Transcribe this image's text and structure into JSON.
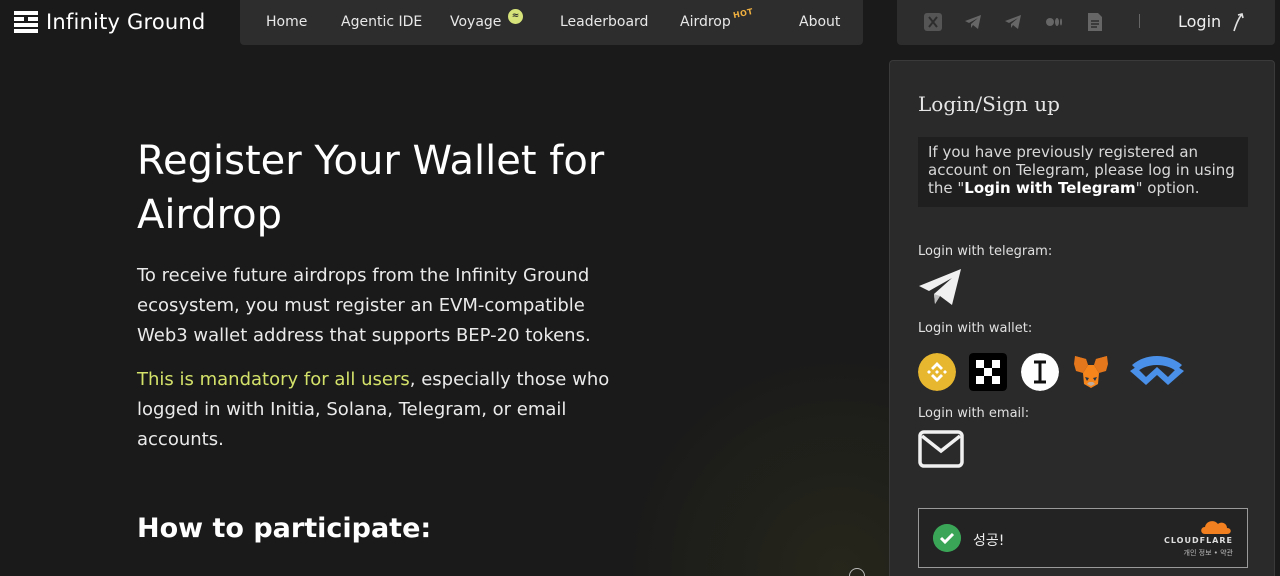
{
  "brand": {
    "name": "Infinity Ground"
  },
  "nav": {
    "items": [
      {
        "label": "Home"
      },
      {
        "label": "Agentic IDE"
      },
      {
        "label": "Voyage"
      },
      {
        "label": "Leaderboard"
      },
      {
        "label": "Airdrop",
        "badge": "HOT"
      },
      {
        "label": "About"
      }
    ]
  },
  "social": {
    "icons": [
      "x-icon",
      "telegram-icon",
      "telegram-icon",
      "medium-icon",
      "docs-icon"
    ],
    "login_label": "Login"
  },
  "main": {
    "title": "Register Your Wallet for Airdrop",
    "para1": "To receive future airdrops from the Infinity Ground ecosystem, you must register an EVM-compatible Web3 wallet address that supports BEP-20 tokens.",
    "para2_highlight": "This is mandatory for all users",
    "para2_rest": ", especially those who logged in with Initia, Solana, Telegram, or email accounts.",
    "how_title": "How to participate:"
  },
  "panel": {
    "title": "Login/Sign up",
    "notice_pre": "If you have previously registered an account on Telegram, please log in using the \"",
    "notice_bold": "Login with Telegram",
    "notice_post": "\" option.",
    "telegram_label": "Login with telegram:",
    "wallet_label": "Login with wallet:",
    "email_label": "Login with email:",
    "wallets": [
      "binance-wallet-icon",
      "okx-wallet-icon",
      "initia-wallet-icon",
      "metamask-icon",
      "walletconnect-icon"
    ],
    "captcha": {
      "status": "성공!",
      "brand": "CLOUDFLARE",
      "links": "개인 정보 • 약관"
    }
  },
  "colors": {
    "background": "#1a1a1a",
    "nav_bg": "#2d2d2d",
    "accent": "#d4e26a",
    "panel_bg": "#2a2a2a",
    "success": "#3aa557"
  }
}
